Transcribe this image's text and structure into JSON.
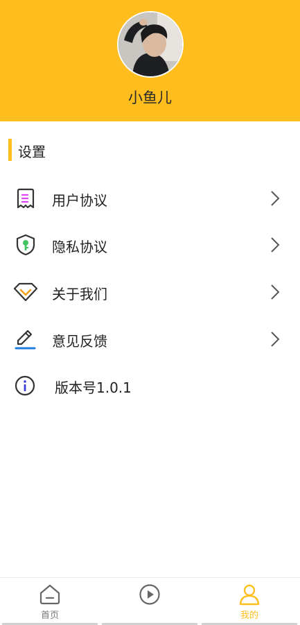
{
  "profile": {
    "username": "小鱼儿"
  },
  "section": {
    "title": "设置"
  },
  "menu": [
    {
      "label": "用户协议",
      "icon": "document-icon",
      "has_arrow": true
    },
    {
      "label": "隐私协议",
      "icon": "shield-key-icon",
      "has_arrow": true
    },
    {
      "label": "关于我们",
      "icon": "diamond-icon",
      "has_arrow": true
    },
    {
      "label": "意见反馈",
      "icon": "edit-pen-icon",
      "has_arrow": true
    },
    {
      "label": "版本号1.0.1",
      "icon": "info-icon",
      "has_arrow": false
    }
  ],
  "tabbar": {
    "tabs": [
      {
        "label": "首页",
        "icon": "home-icon",
        "active": false
      },
      {
        "label": "",
        "icon": "play-icon",
        "active": false
      },
      {
        "label": "我的",
        "icon": "user-icon",
        "active": true
      }
    ]
  },
  "colors": {
    "accent": "#FFBE1E",
    "text": "#222222",
    "icon_pink": "#E040FB",
    "icon_green": "#43C463",
    "icon_orange": "#F5A01A",
    "icon_blue": "#1E7BE0"
  }
}
